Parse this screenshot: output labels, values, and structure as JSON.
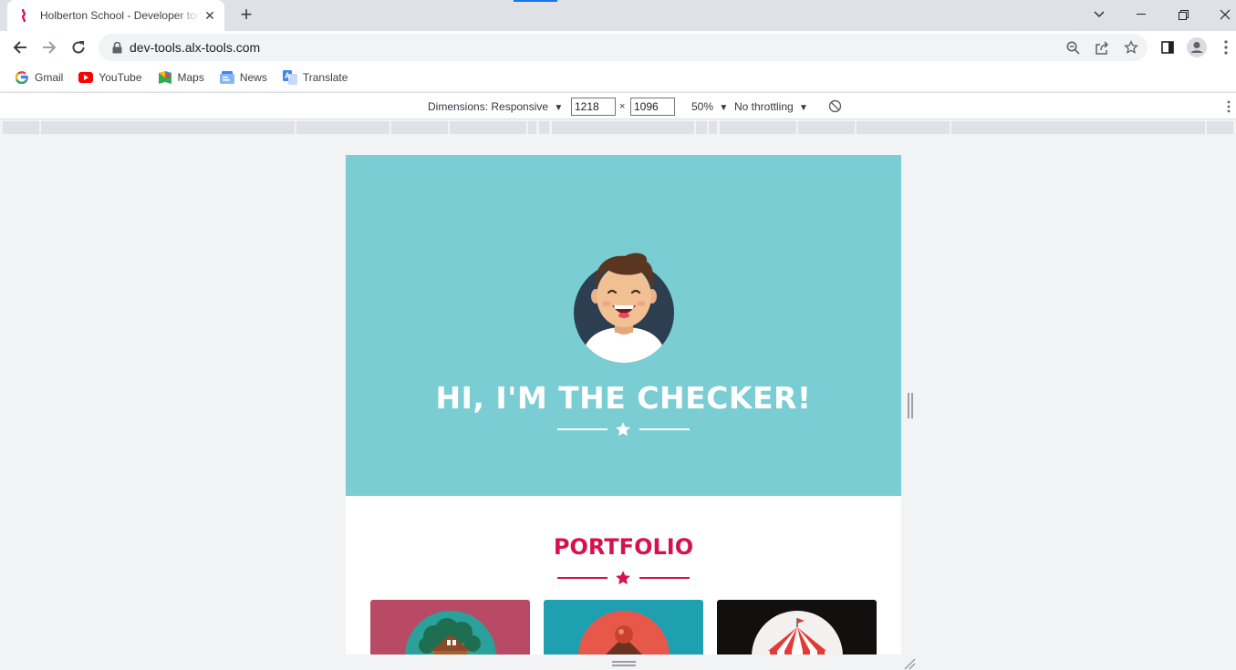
{
  "browser": {
    "tab_title": "Holberton School - Developer tools",
    "tab_close": "✕",
    "new_tab": "+",
    "url": "dev-tools.alx-tools.com"
  },
  "bookmarks": [
    {
      "label": "Gmail",
      "icon": "google-icon"
    },
    {
      "label": "YouTube",
      "icon": "youtube-icon"
    },
    {
      "label": "Maps",
      "icon": "maps-icon"
    },
    {
      "label": "News",
      "icon": "news-icon"
    },
    {
      "label": "Translate",
      "icon": "translate-icon"
    }
  ],
  "devtools": {
    "dimensions_label": "Dimensions: Responsive",
    "width_value": "1218",
    "times": "×",
    "height_value": "1096",
    "zoom": "50%",
    "throttling": "No throttling",
    "caret": "▼"
  },
  "page": {
    "hero_title": "HI, I'M THE CHECKER!",
    "portfolio_title": "PORTFOLIO",
    "colors": {
      "hero_bg": "#7acdd3",
      "accent": "#d4134c",
      "card_1": "#b94a66",
      "card_2": "#1fa0b1",
      "card_3": "#120f0f"
    }
  }
}
